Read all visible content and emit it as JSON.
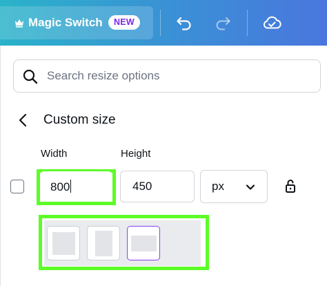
{
  "toolbar": {
    "magic_switch_label": "Magic Switch",
    "new_badge": "NEW",
    "icons": [
      "crown-icon",
      "undo-icon",
      "redo-icon",
      "cloud-saved-icon"
    ]
  },
  "search": {
    "placeholder": "Search resize options"
  },
  "custom_size": {
    "title": "Custom size",
    "width_label": "Width",
    "height_label": "Height",
    "width_value": "800",
    "height_value": "450",
    "unit": "px",
    "presets": [
      "square",
      "portrait",
      "landscape"
    ],
    "selected_preset": "landscape"
  },
  "colors": {
    "toolbar_gradient_start": "#2ab3c9",
    "toolbar_gradient_end": "#4a76de",
    "badge_text": "#7d2ae8",
    "highlight": "#5dfc26",
    "selected_preset_border": "#8b3ff0"
  }
}
